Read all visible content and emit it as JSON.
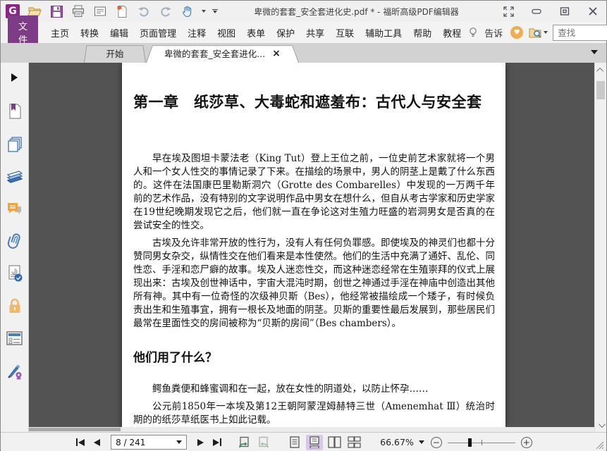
{
  "window": {
    "title": "卑微的套套_安全套进化史.pdf * - 福昕高级PDF编辑器"
  },
  "menubar": {
    "file_label": "文件",
    "items": [
      "主页",
      "转换",
      "编辑",
      "页面管理",
      "注释",
      "视图",
      "表单",
      "保护",
      "共享",
      "互联",
      "辅助工具",
      "帮助",
      "教程"
    ],
    "tell_me_label": "告诉",
    "search_placeholder": "查找"
  },
  "tabs": {
    "items": [
      {
        "label": "开始"
      },
      {
        "label": "卑微的套套_安全套进化...",
        "close_glyph": "×"
      }
    ],
    "active_index": 1
  },
  "sidebar": {
    "icons": [
      "expand-panel",
      "bookmarks",
      "page-thumbnails",
      "layers",
      "comments",
      "attachments",
      "digital-ids",
      "security",
      "field-panel",
      "signatures"
    ]
  },
  "document": {
    "chapter_title": "第一章　纸莎草、大毒蛇和遮羞布：古代人与安全套",
    "paragraph_1": "早在埃及图坦卡蒙法老（King Tut）登上王位之前，一位史前艺术家就将一个男人和一个女人性交的事情记录了下来。在描绘的场景中，男人的阴茎上是戴了什么东西的。这件在法国康巴里勒斯洞穴（Grotte des Combarelles）中发现的一万两千年前的艺术作品，没有特别的文字说明作品中男女在想什么，但自从考古学家和历史学家在19世纪晚期发现它之后，他们就一直在争论这对生殖力旺盛的岩洞男女是否真的在尝试安全的性交。",
    "paragraph_2": "古埃及允许非常开放的性行为，没有人有任何负罪感。即使埃及的神灵们也都十分赞同男女杂交，纵情性交在他们看来是本性使然。他们的生活中充满了通奸、乱伦、同性恋、手淫和恋尸癖的故事。埃及人迷恋性交，而这种迷恋经常在生殖崇拜的仪式上展现出来：古埃及创世神话中，宇宙大混沌时期，创世之神通过手淫在神庙中创造出其他所有神。其中有一位奇怪的次级神贝斯（Bes），他经常被描绘成一个矮子，有时候负责出生和生殖事宜，拥有一根长及地面的阴茎。贝斯的重要性最后发展到，那些居民们最常在里面性交的房间被称为“贝斯的房间”（Bes chambers）。",
    "section_heading": "他们用了什么？",
    "paragraph_3": "鳄鱼粪便和蜂蜜调和在一起，放在女性的阴道处，以防止怀孕……",
    "paragraph_4": "公元前1850年一本埃及第12王朝阿蒙涅姆赫特三世（Amenemhat Ⅲ）统治时期的的纸莎草纸医书上如此记载。"
  },
  "statusbar": {
    "page_display": "8 / 241",
    "zoom_value": "66.67%"
  },
  "colors": {
    "accent_purple": "#7d3c85",
    "logo_purple": "#8a2585",
    "doc_background": "#535353",
    "active_layout_bg": "#d9c7ea",
    "heart_orange": "#f0ad4e"
  }
}
